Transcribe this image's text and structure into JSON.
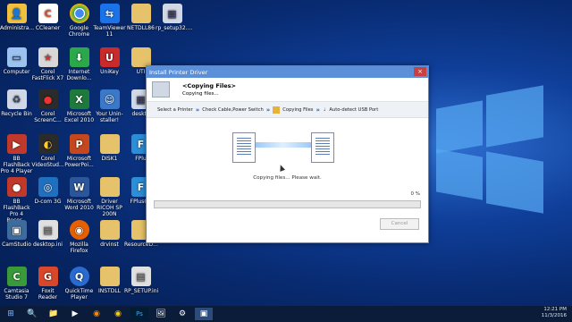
{
  "desktop": {
    "icons": [
      {
        "label": "Administra...",
        "glyph": "👤",
        "color": "#f0c040"
      },
      {
        "label": "CCleaner",
        "glyph": "C",
        "color": "#e04a2a"
      },
      {
        "label": "Google Chrome",
        "glyph": "◉",
        "color": "#e8b900"
      },
      {
        "label": "TeamViewer 11",
        "glyph": "⇆",
        "color": "#1a73e8"
      },
      {
        "label": "NETDLL86",
        "glyph": "📁",
        "color": "#e6c36a"
      },
      {
        "label": "rp_setup32....",
        "glyph": "▦",
        "color": "#cfd8e4"
      },
      {
        "label": "Computer",
        "glyph": "🖥",
        "color": "#9cc3f0"
      },
      {
        "label": "Corel FastFlick X7",
        "glyph": "★",
        "color": "#d8d8d8"
      },
      {
        "label": "Internet Downlo...",
        "glyph": "⬇",
        "color": "#2aa84a"
      },
      {
        "label": "UniKey",
        "glyph": "U",
        "color": "#c92a2a"
      },
      {
        "label": "UTI",
        "glyph": "📁",
        "color": "#e6c36a"
      },
      {
        "label": "Recycle Bin",
        "glyph": "🗑",
        "color": "#d0d8e8"
      },
      {
        "label": "Corel ScreenC...",
        "glyph": "●",
        "color": "#2b2b2b"
      },
      {
        "label": "Microsoft Excel 2010",
        "glyph": "X",
        "color": "#1e7a3c"
      },
      {
        "label": "Your Unin-staller!",
        "glyph": "☺",
        "color": "#3a78c9"
      },
      {
        "label": "deskto",
        "glyph": "▦",
        "color": "#cfd8e4"
      },
      {
        "label": "BB FlashBack Pro 4 Player",
        "glyph": "▶",
        "color": "#c0392b"
      },
      {
        "label": "Corel VideoStud...",
        "glyph": "◐",
        "color": "#2b2b2b"
      },
      {
        "label": "Microsoft PowerPoi...",
        "glyph": "P",
        "color": "#c4471d"
      },
      {
        "label": "DISK1",
        "glyph": "📁",
        "color": "#e6c36a"
      },
      {
        "label": "FPlu",
        "glyph": "F",
        "color": "#2b8fd8"
      },
      {
        "label": "BB FlashBack Pro 4 Recor...",
        "glyph": "●",
        "color": "#c0392b"
      },
      {
        "label": "D-com 3G",
        "glyph": "◎",
        "color": "#2070c0"
      },
      {
        "label": "Microsoft Word 2010",
        "glyph": "W",
        "color": "#2b579a"
      },
      {
        "label": "Driver RICOH SP 200N",
        "glyph": "📁",
        "color": "#e6c36a"
      },
      {
        "label": "FPlusCh",
        "glyph": "F",
        "color": "#2b8fd8"
      },
      {
        "label": "CamStudio",
        "glyph": "▣",
        "color": "#3d6b9b"
      },
      {
        "label": "desktop.ini",
        "glyph": "▤",
        "color": "#e0e0e0"
      },
      {
        "label": "Mozilla Firefox",
        "glyph": "◉",
        "color": "#e66000"
      },
      {
        "label": "drvinst",
        "glyph": "📁",
        "color": "#e6c36a"
      },
      {
        "label": "ResourceD...",
        "glyph": "📁",
        "color": "#e6c36a"
      },
      {
        "label": "Camtasia Studio 7",
        "glyph": "C",
        "color": "#3a9a3a"
      },
      {
        "label": "Foxit Reader",
        "glyph": "G",
        "color": "#d9472b"
      },
      {
        "label": "QuickTime Player",
        "glyph": "Q",
        "color": "#2a6bd1"
      },
      {
        "label": "INSTDLL",
        "glyph": "📁",
        "color": "#e6c36a"
      },
      {
        "label": "RP_SETUP.ini",
        "glyph": "▤",
        "color": "#e0e0e0"
      }
    ]
  },
  "dialog": {
    "title": "Install Printer Driver",
    "close": "×",
    "header_title": "<Copying Files>",
    "header_sub": "Copying files...",
    "steps": [
      "Select a Printer",
      "Check Cable,Power Switch",
      "Copying Files",
      "Auto-detect USB Port"
    ],
    "status": "Copying files... Please wait.",
    "percent": "0 %",
    "progress": 0,
    "cancel": "Cancel"
  },
  "taskbar": {
    "start": "⊞",
    "items": [
      "🔍",
      "📁",
      "▶",
      "◉",
      "◉",
      "Ps",
      "🖼",
      "⚙",
      "▣"
    ],
    "time": "12:21 PM",
    "date": "11/3/2016"
  }
}
